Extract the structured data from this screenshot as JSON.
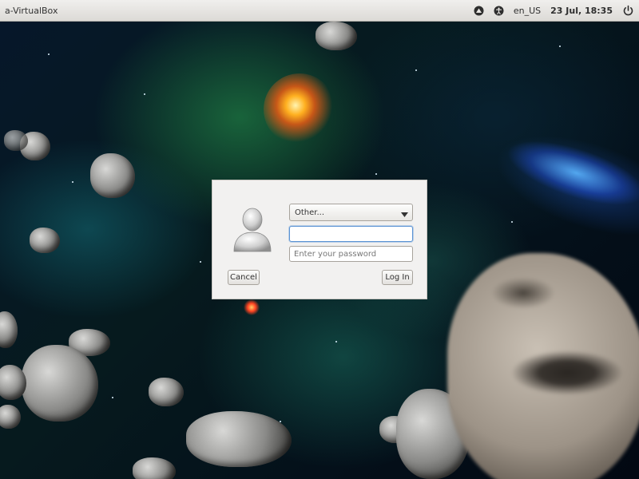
{
  "panel": {
    "title": "a-VirtualBox",
    "keyboard_layout": "en_US",
    "clock": "23 Jul, 18:35",
    "icons": [
      "network-icon",
      "accessibility-icon",
      "power-icon"
    ]
  },
  "login": {
    "user_select": {
      "selected": "Other..."
    },
    "username": {
      "value": "",
      "placeholder": ""
    },
    "password": {
      "value": "",
      "placeholder": "Enter your password"
    },
    "cancel_label": "Cancel",
    "login_label": "Log In"
  },
  "colors": {
    "panel_bg": "#e6e4e1",
    "dialog_bg": "#f2f1f0",
    "focus_border": "#5b93d4"
  }
}
